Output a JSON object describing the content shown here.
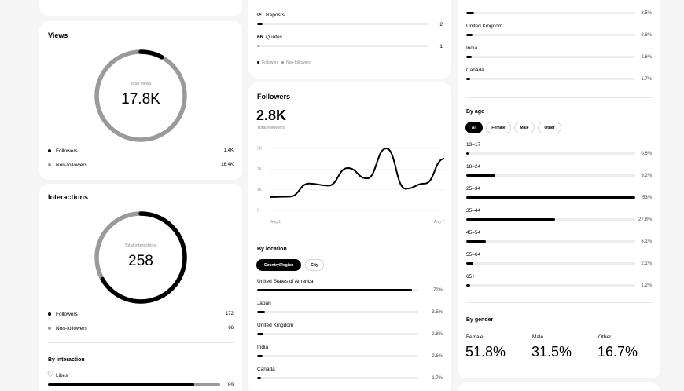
{
  "views": {
    "title": "Views",
    "center_label": "Total views",
    "center_value": "17.8K",
    "followers_fraction": 0.079,
    "rows": [
      {
        "label": "Followers",
        "value": "1.4K"
      },
      {
        "label": "Non-followers",
        "value": "16.4K"
      }
    ]
  },
  "interactions": {
    "title": "Interactions",
    "center_label": "Total interactions",
    "center_value": "258",
    "followers_fraction": 0.667,
    "rows": [
      {
        "label": "Followers",
        "value": "172"
      },
      {
        "label": "Non-followers",
        "value": "86"
      }
    ],
    "by_interaction_title": "By interaction",
    "likes": {
      "icon": "heart-icon",
      "label": "Likes",
      "value": "89",
      "followers_fraction": 0.85
    }
  },
  "interaction_types": {
    "reposts": {
      "icon": "repost-icon",
      "icon_glyph": "⟳",
      "label": "Reposts",
      "value": "2",
      "fraction": 0.03
    },
    "quotes": {
      "icon": "quote-icon",
      "icon_glyph": "66",
      "label": "Quotes",
      "value": "1",
      "fraction": 0.015
    },
    "legend": [
      "Followers",
      "Non-followers"
    ]
  },
  "followers": {
    "title": "Followers",
    "total": "2.8K",
    "total_label": "Total followers",
    "chart_data": {
      "type": "line",
      "x_labels": [
        "Aug 1",
        "Aug 7"
      ],
      "y_ticks": [
        "3K",
        "2K",
        "1K",
        "0"
      ],
      "ylim": [
        0,
        3000
      ],
      "values": [
        650,
        670,
        1300,
        1200,
        2050,
        1550,
        3000,
        1050,
        1300,
        2500
      ]
    },
    "by_location": {
      "title": "By location",
      "tabs": [
        "Country/Region",
        "City"
      ],
      "active_tab": 0,
      "rows": [
        {
          "label": "United States of America",
          "pct": "72%",
          "value": 72
        },
        {
          "label": "Japan",
          "pct": "3.5%",
          "value": 3.5
        },
        {
          "label": "United Kingdom",
          "pct": "2.8%",
          "value": 2.8
        },
        {
          "label": "India",
          "pct": "2.6%",
          "value": 2.6
        },
        {
          "label": "Canada",
          "pct": "1.7%",
          "value": 1.7
        }
      ]
    }
  },
  "right": {
    "top_rows": [
      {
        "label": "",
        "pct": "3.5%",
        "value": 3.5
      },
      {
        "label": "United Kingdom",
        "pct": "2.8%",
        "value": 2.8
      },
      {
        "label": "India",
        "pct": "2.6%",
        "value": 2.6
      },
      {
        "label": "Canada",
        "pct": "1.7%",
        "value": 1.7
      }
    ],
    "by_age": {
      "title": "By age",
      "tabs": [
        "All",
        "Female",
        "Male",
        "Other"
      ],
      "active_tab": 0,
      "rows": [
        {
          "label": "13–17",
          "pct": "0.6%",
          "value": 0.6
        },
        {
          "label": "18–24",
          "pct": "9.2%",
          "value": 9.2
        },
        {
          "label": "25–34",
          "pct": "53%",
          "value": 53
        },
        {
          "label": "35–44",
          "pct": "27.8%",
          "value": 27.8
        },
        {
          "label": "45–54",
          "pct": "6.1%",
          "value": 6.1
        },
        {
          "label": "55–64",
          "pct": "2.1%",
          "value": 2.1
        },
        {
          "label": "65+",
          "pct": "1.2%",
          "value": 1.2
        }
      ]
    },
    "by_gender": {
      "title": "By gender",
      "items": [
        {
          "label": "Female",
          "value": "51.8%"
        },
        {
          "label": "Male",
          "value": "31.5%"
        },
        {
          "label": "Other",
          "value": "16.7%"
        }
      ]
    }
  },
  "colors": {
    "followers": "#000000",
    "non_followers": "#9a9a9a",
    "track": "#ececec"
  }
}
